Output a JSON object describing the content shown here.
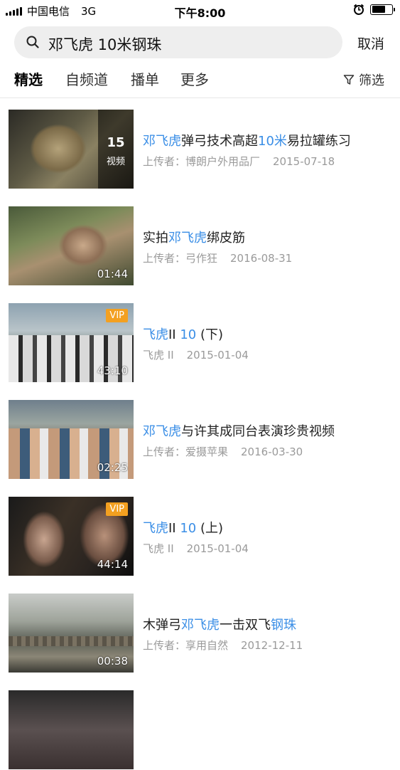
{
  "status_bar": {
    "carrier": "中国电信",
    "network": "3G",
    "time": "下午8:00"
  },
  "search": {
    "query": "邓飞虎 10米钢珠",
    "cancel_label": "取消"
  },
  "tabs": [
    {
      "label": "精选",
      "active": true
    },
    {
      "label": "自频道",
      "active": false
    },
    {
      "label": "播单",
      "active": false
    },
    {
      "label": "更多",
      "active": false
    }
  ],
  "filter_label": "筛选",
  "colors": {
    "highlight": "#3a8ee6",
    "vip_badge": "#f3a020",
    "meta_text": "#9a9a9a"
  },
  "results": [
    {
      "title_parts": [
        {
          "t": "邓飞虎",
          "hl": true
        },
        {
          "t": "弹弓技术高超",
          "hl": false
        },
        {
          "t": "10米",
          "hl": true
        },
        {
          "t": "易拉罐练习",
          "hl": false
        }
      ],
      "uploader": "上传者：博朗户外用品厂",
      "date": "2015-07-18",
      "count": "15",
      "count_label": "视频"
    },
    {
      "title_parts": [
        {
          "t": "实拍",
          "hl": false
        },
        {
          "t": "邓飞虎",
          "hl": true
        },
        {
          "t": "绑皮筋",
          "hl": false
        }
      ],
      "uploader": "上传者：弓作狂",
      "date": "2016-08-31",
      "duration": "01:44"
    },
    {
      "title_parts": [
        {
          "t": "飞虎",
          "hl": true
        },
        {
          "t": "II ",
          "hl": false
        },
        {
          "t": "10",
          "hl": true
        },
        {
          "t": " (下)",
          "hl": false
        }
      ],
      "uploader": "飞虎 II",
      "date": "2015-01-04",
      "duration": "43:10",
      "vip": "VIP"
    },
    {
      "title_parts": [
        {
          "t": "邓飞虎",
          "hl": true
        },
        {
          "t": "与许其成同台表演珍贵视频",
          "hl": false
        }
      ],
      "uploader": "上传者：爱摄苹果",
      "date": "2016-03-30",
      "duration": "02:25"
    },
    {
      "title_parts": [
        {
          "t": "飞虎",
          "hl": true
        },
        {
          "t": "II ",
          "hl": false
        },
        {
          "t": "10",
          "hl": true
        },
        {
          "t": " (上)",
          "hl": false
        }
      ],
      "uploader": "飞虎 II",
      "date": "2015-01-04",
      "duration": "44:14",
      "vip": "VIP"
    },
    {
      "title_parts": [
        {
          "t": "木弹弓",
          "hl": false
        },
        {
          "t": "邓飞虎",
          "hl": true
        },
        {
          "t": "一击双飞",
          "hl": false
        },
        {
          "t": "钢珠",
          "hl": true
        }
      ],
      "uploader": "上传者：享用自然",
      "date": "2012-12-11",
      "duration": "00:38"
    }
  ]
}
